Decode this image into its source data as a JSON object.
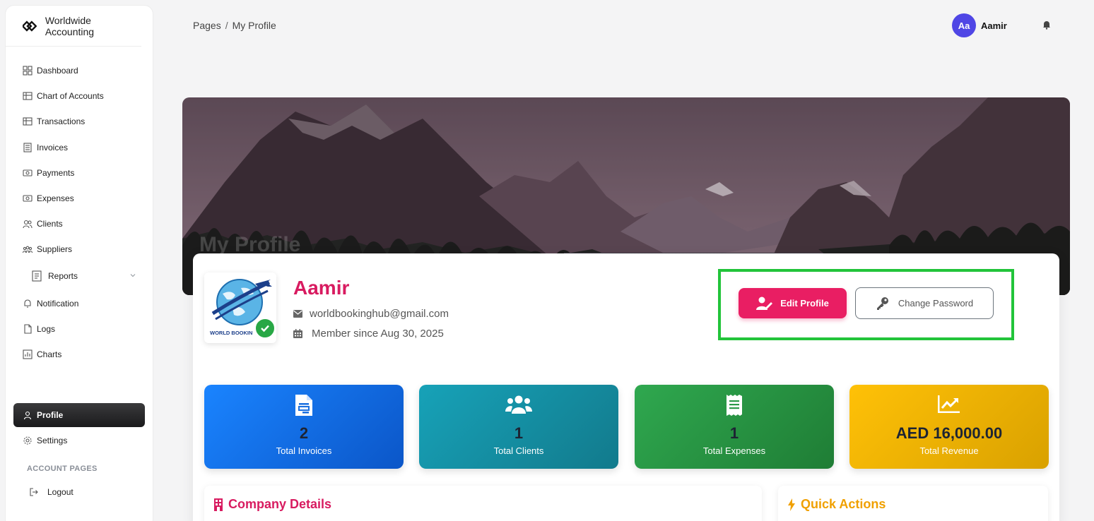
{
  "brand": {
    "name": "Worldwide Accounting",
    "logo_icon": "diamond-logo-icon"
  },
  "sidebar": {
    "items": [
      {
        "label": "Dashboard",
        "icon": "dashboard-icon"
      },
      {
        "label": "Chart of Accounts",
        "icon": "table-icon"
      },
      {
        "label": "Transactions",
        "icon": "table-icon"
      },
      {
        "label": "Invoices",
        "icon": "invoice-icon"
      },
      {
        "label": "Payments",
        "icon": "money-icon"
      },
      {
        "label": "Expenses",
        "icon": "money-icon"
      },
      {
        "label": "Clients",
        "icon": "users-icon"
      },
      {
        "label": "Suppliers",
        "icon": "group-icon"
      },
      {
        "label": "Reports",
        "icon": "report-icon"
      },
      {
        "label": "Notification",
        "icon": "bell-icon"
      },
      {
        "label": "Logs",
        "icon": "file-icon"
      },
      {
        "label": "Charts",
        "icon": "bar-chart-icon"
      },
      {
        "label": "Profile",
        "icon": "user-icon",
        "active": true
      },
      {
        "label": "Settings",
        "icon": "gear-icon"
      }
    ],
    "section_label": "ACCOUNT PAGES",
    "logout_label": "Logout"
  },
  "breadcrumb": {
    "parent": "Pages",
    "separator": "/",
    "current": "My Profile"
  },
  "user": {
    "initials": "Aa",
    "name": "Aamir"
  },
  "hero": {
    "title": "My Profile"
  },
  "profile": {
    "name": "Aamir",
    "email": "worldbookinghub@gmail.com",
    "member_since": "Member since Aug 30, 2025",
    "logo_text": "WORLD BOOKIN"
  },
  "actions": {
    "edit_label": "Edit Profile",
    "password_label": "Change Password"
  },
  "stats": [
    {
      "value": "2",
      "label": "Total Invoices",
      "icon": "invoice-icon"
    },
    {
      "value": "1",
      "label": "Total Clients",
      "icon": "users-icon"
    },
    {
      "value": "1",
      "label": "Total Expenses",
      "icon": "receipt-icon"
    },
    {
      "value": "AED 16,000.00",
      "label": "Total Revenue",
      "icon": "trend-chart-icon"
    }
  ],
  "panels": {
    "company_title": "Company Details",
    "quick_title": "Quick Actions"
  },
  "colors": {
    "accent": "#e91e63",
    "highlight": "#22c43a",
    "sidebar_active": "#1a1a1c"
  }
}
